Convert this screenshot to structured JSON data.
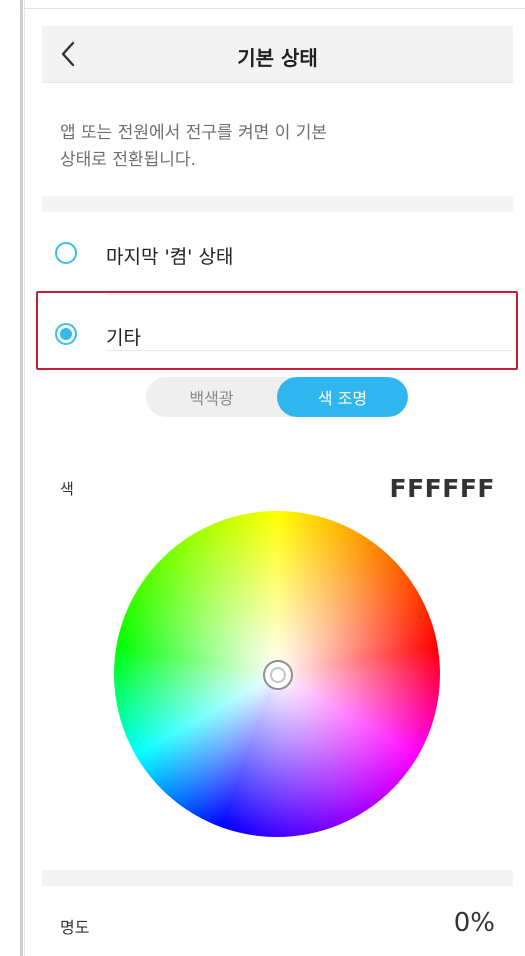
{
  "header": {
    "title": "기본 상태",
    "back_icon": "chevron-left-icon"
  },
  "description": "앱 또는 전원에서 전구를 켜면 이 기본\n상태로 전환됩니다.",
  "options": [
    {
      "label": "마지막 '켬' 상태",
      "selected": false
    },
    {
      "label": "기타",
      "selected": true
    }
  ],
  "mode_toggle": {
    "white_label": "백색광",
    "color_label": "색 조명",
    "active": "color"
  },
  "color": {
    "label": "색",
    "hex": "FFFFFF"
  },
  "brightness": {
    "label": "명도",
    "value": "0%"
  },
  "colors": {
    "accent": "#2fb6ef",
    "highlight_border": "#c21f3a"
  }
}
